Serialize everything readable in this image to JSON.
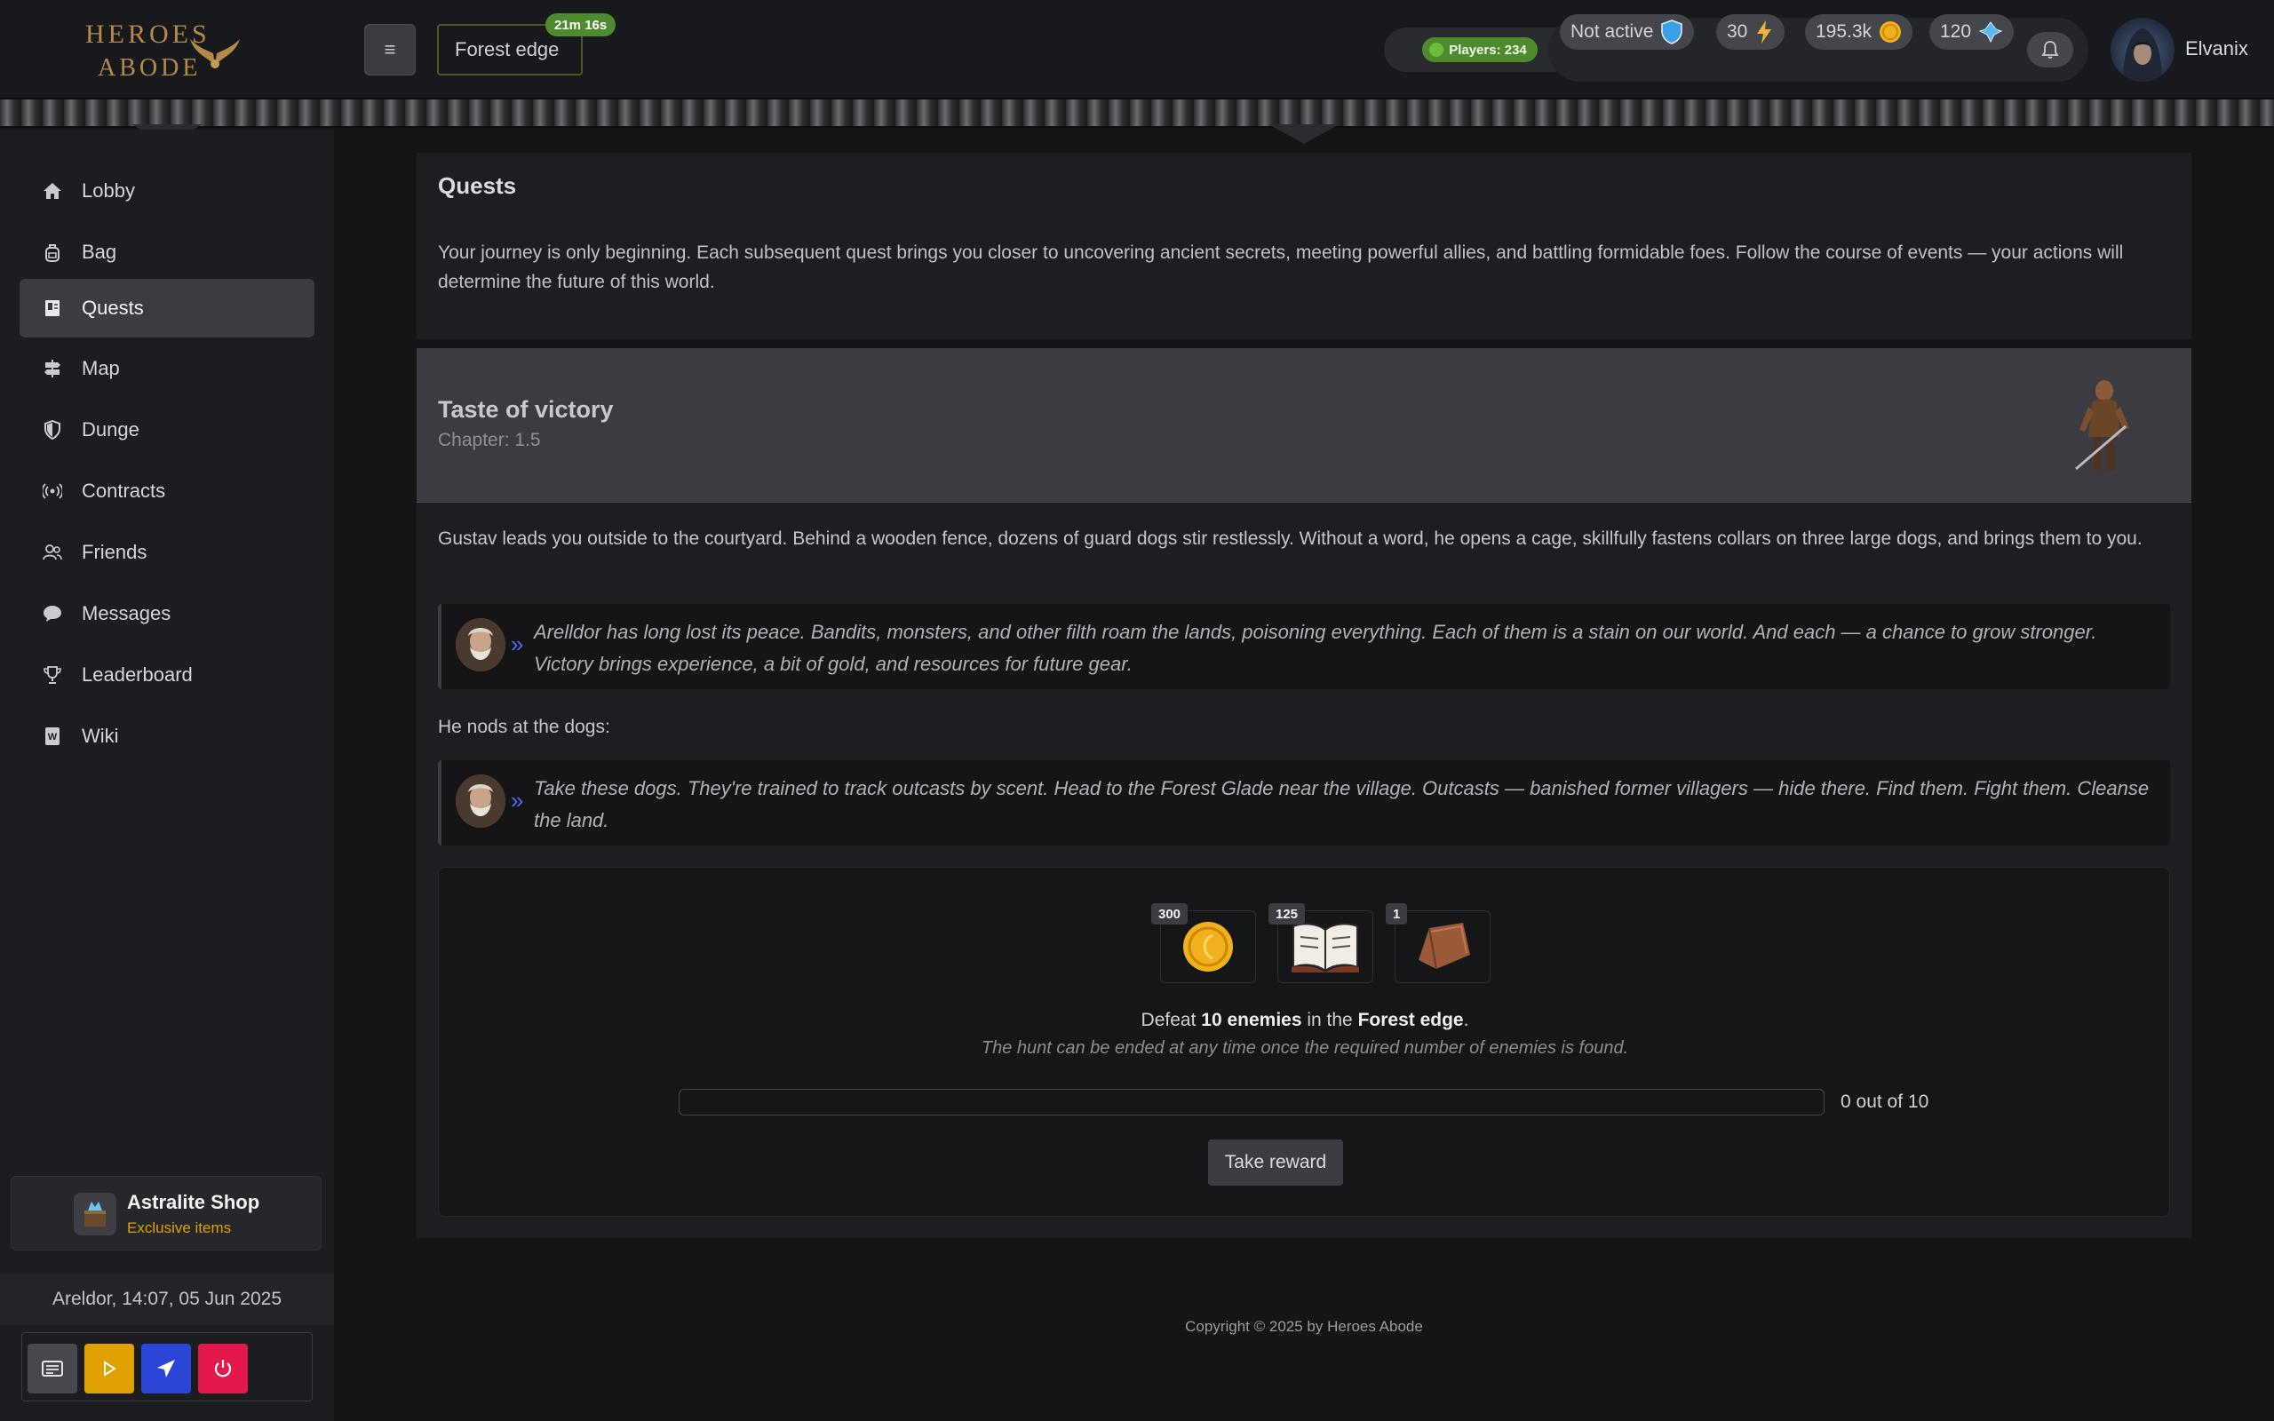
{
  "brand": {
    "logo_line1": "HEROES",
    "logo_line2": "ABODE"
  },
  "header": {
    "location": "Forest edge",
    "timer": "21m 16s",
    "players": "Players: 234",
    "activity": "Not active",
    "energy": "30",
    "gold": "195.3k",
    "astralite": "120",
    "username": "Elvanix"
  },
  "sidebar": {
    "items": [
      {
        "label": "Lobby",
        "icon": "home-icon"
      },
      {
        "label": "Bag",
        "icon": "backpack-icon"
      },
      {
        "label": "Quests",
        "icon": "book-icon",
        "active": true
      },
      {
        "label": "Map",
        "icon": "signpost-icon"
      },
      {
        "label": "Dunge",
        "icon": "shield-icon"
      },
      {
        "label": "Contracts",
        "icon": "broadcast-icon"
      },
      {
        "label": "Friends",
        "icon": "people-icon"
      },
      {
        "label": "Messages",
        "icon": "chat-icon"
      },
      {
        "label": "Leaderboard",
        "icon": "trophy-icon"
      },
      {
        "label": "Wiki",
        "icon": "wiki-icon"
      }
    ],
    "shop_title": "Astralite Shop",
    "shop_subtitle": "Exclusive items",
    "clock": "Areldor, 14:07, 05 Jun 2025"
  },
  "intro": {
    "title": "Quests",
    "text": "Your journey is only beginning. Each subsequent quest brings you closer to uncovering ancient secrets, meeting powerful allies, and battling formidable foes. Follow the course of events — your actions will determine the future of this world."
  },
  "quest": {
    "title": "Taste of victory",
    "chapter": "Chapter: 1.5",
    "paragraph1": "Gustav leads you outside to the courtyard. Behind a wooden fence, dozens of guard dogs stir restlessly. Without a word, he opens a cage, skillfully fastens collars on three large dogs, and brings them to you.",
    "quote1": "Arelldor has long lost its peace. Bandits, monsters, and other filth roam the lands, poisoning everything. Each of them is a stain on our world. And each — a chance to grow stronger. Victory brings experience, a bit of gold, and resources for future gear.",
    "paragraph2": "He nods at the dogs:",
    "quote2": "Take these dogs. They're trained to track outcasts by scent. Head to the Forest Glade near the village. Outcasts — banished former villagers — hide there. Find them. Fight them. Cleanse the land.",
    "rewards": [
      {
        "count": "300",
        "icon": "gold-coin-icon"
      },
      {
        "count": "125",
        "icon": "open-book-icon"
      },
      {
        "count": "1",
        "icon": "leather-icon"
      }
    ],
    "objective_pre": "Defeat ",
    "objective_count": "10 enemies",
    "objective_mid": " in the ",
    "objective_place": "Forest edge",
    "objective_post": ".",
    "hint": "The hunt can be ended at any time once the required number of enemies is found.",
    "progress_fraction": 0,
    "progress_label": "0 out of 10",
    "button": "Take reward"
  },
  "footer": {
    "copyright": "Copyright © 2025 by Heroes Abode"
  },
  "colors": {
    "accent_green": "#4e8b2d",
    "gold": "#e0a100",
    "quote_chevron": "#4d6bf0"
  }
}
